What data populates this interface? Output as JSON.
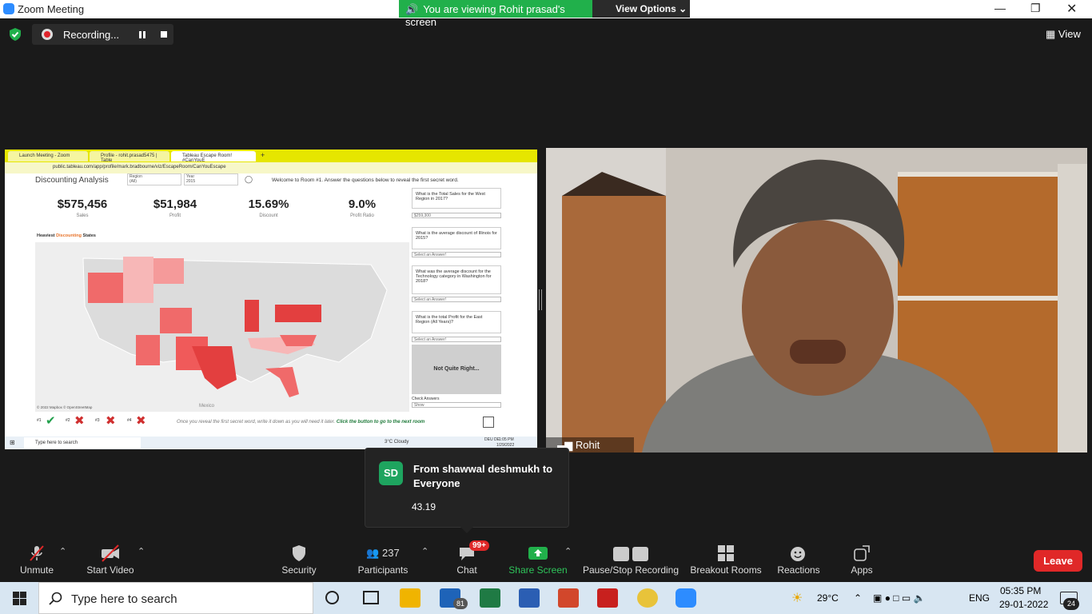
{
  "window": {
    "title": "Zoom Meeting"
  },
  "banner": {
    "viewing": "You are viewing Rohit prasad's screen",
    "view_options": "View Options"
  },
  "recording": {
    "label": "Recording..."
  },
  "view_button": {
    "label": "View"
  },
  "shared_screen": {
    "tabs": [
      "Launch Meeting - Zoom",
      "Profile - rohit.prasad5475 | Table",
      "Tableau Escape Room! #CanYouE"
    ],
    "url": "public.tableau.com/app/profile/mark.bradbourne/viz/EscapeRoom/CanYouEscape",
    "dashboard_title": "Discounting Analysis",
    "filters": [
      {
        "label": "Region",
        "value": "(All)"
      },
      {
        "label": "Year",
        "value": "2015"
      }
    ],
    "welcome": "Welcome to Room #1. Answer the questions below to reveal the first secret word.",
    "kpis": [
      {
        "value": "$575,456",
        "label": "Sales"
      },
      {
        "value": "$51,984",
        "label": "Profit"
      },
      {
        "value": "15.69%",
        "label": "Discount"
      },
      {
        "value": "9.0%",
        "label": "Profit Ratio"
      }
    ],
    "map_title_1": "Heaviest ",
    "map_title_2": "Discounting",
    "map_title_3": " States",
    "map_credit": "© 2022 Mapbox © OpenStreetMap",
    "map_country": "Mexico",
    "questions": [
      {
        "q": "What is the Total Sales for the West Region in 2017?",
        "a": "$259,300"
      },
      {
        "q": "What is the average discount of Illinois for 2015?",
        "a": "Select an Answer!"
      },
      {
        "q": "What was the average discount for the Technology category in Washington for 2018?",
        "a": "Select an Answer!"
      },
      {
        "q": "What is the total Profit for the East Region (All Years)?",
        "a": "Select an Answer!"
      }
    ],
    "result": "Not Quite Right...",
    "check_answers": "Check Answers",
    "check_value": "Show",
    "progress": [
      "#1",
      "#2",
      "#3",
      "#4"
    ],
    "footer_note": "Once you reveal the first secret word, write it down as you will need it later.",
    "footer_link": "Click the button to go to the next room",
    "taskbar_search": "Type here to search",
    "weather": "3°C Cloudy",
    "lang": "DEU DE",
    "time": "1:05 PM",
    "date": "1/29/2022"
  },
  "camera": {
    "name": "Rohit prasad"
  },
  "chat_popup": {
    "initials": "SD",
    "from": "From shawwal deshmukh to Everyone",
    "message": "43.19"
  },
  "toolbar": {
    "unmute": "Unmute",
    "start_video": "Start Video",
    "security": "Security",
    "participants": "Participants",
    "participants_count": "237",
    "chat": "Chat",
    "chat_badge": "99+",
    "share": "Share Screen",
    "record": "Pause/Stop Recording",
    "breakout": "Breakout Rooms",
    "reactions": "Reactions",
    "apps": "Apps",
    "leave": "Leave"
  },
  "taskbar": {
    "search": "Type here to search",
    "mail_badge": "81",
    "temp": "29°C",
    "lang": "ENG",
    "time": "05:35 PM",
    "date": "29-01-2022",
    "notif": "24"
  }
}
